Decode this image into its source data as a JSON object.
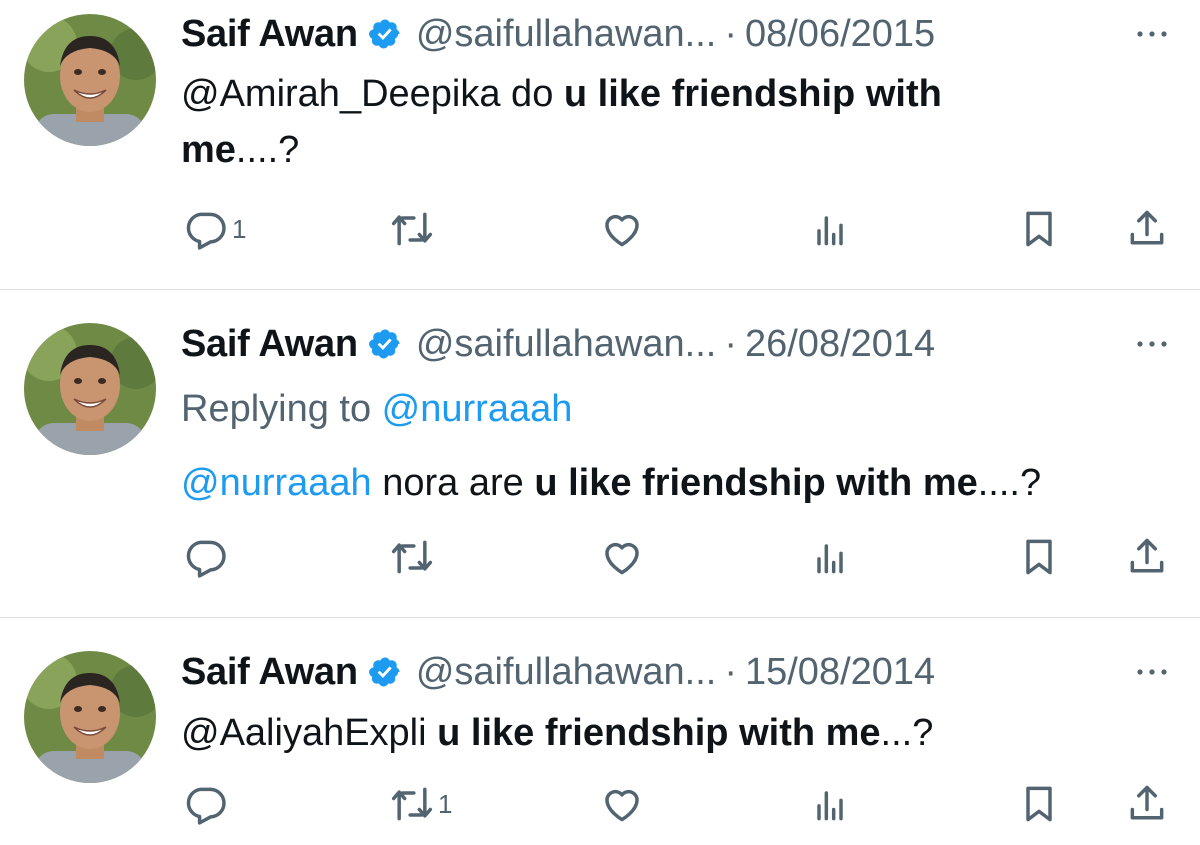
{
  "tweets": [
    {
      "author": "Saif Awan",
      "handle": "@saifullahawan...",
      "separator": "·",
      "date": "08/06/2015",
      "body": {
        "mention": "@Amirah_Deepika",
        "plain": " do ",
        "bold_line1": "u like friendship with",
        "bold_line2": "me",
        "tail": "....?"
      },
      "reply_count": "1",
      "retweet_count": ""
    },
    {
      "author": "Saif Awan",
      "handle": "@saifullahawan...",
      "separator": "·",
      "date": "26/08/2014",
      "replying_prefix": "Replying to ",
      "replying_to": "@nurraaah",
      "body": {
        "mention": "@nurraaah",
        "plain": " nora are ",
        "bold": "u like friendship with me",
        "tail": "....?"
      },
      "reply_count": "",
      "retweet_count": ""
    },
    {
      "author": "Saif Awan",
      "handle": "@saifullahawan...",
      "separator": "·",
      "date": "15/08/2014",
      "body": {
        "mention": "@AaliyahExpli",
        "plain": " ",
        "bold": "u like friendship with me",
        "tail": "...?"
      },
      "reply_count": "",
      "retweet_count": "1"
    }
  ],
  "icons": {
    "reply": "reply-icon",
    "retweet": "retweet-icon",
    "like": "heart-icon",
    "views": "views-icon",
    "bookmark": "bookmark-icon",
    "share": "share-icon",
    "more": "more-icon",
    "verified": "verified-badge-icon"
  },
  "colors": {
    "text": "#0f1419",
    "secondary": "#536471",
    "link": "#1d9bf0",
    "verified": "#1d9bf0",
    "divider": "#dfe3e6"
  }
}
